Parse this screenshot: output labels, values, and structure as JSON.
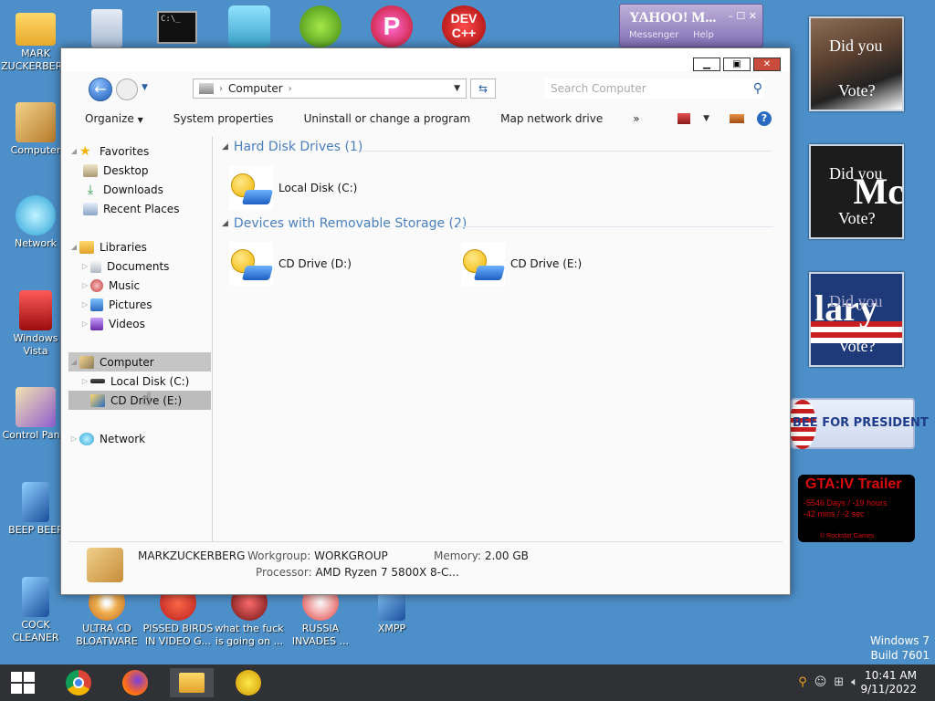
{
  "desktop": {
    "icons": [
      {
        "label": "MARK ZUCKERBERG",
        "icon": "folder-icon"
      },
      {
        "label": "Computer",
        "icon": "computer-icon"
      },
      {
        "label": "Network",
        "icon": "network-icon"
      },
      {
        "label": "Windows Vista",
        "icon": "recycle-bin-icon"
      },
      {
        "label": "Control Panel",
        "icon": "control-panel-icon"
      },
      {
        "label": "BEEP BEEP",
        "icon": "app-icon"
      },
      {
        "label": "COCK CLEANER",
        "icon": "app-icon"
      },
      {
        "label": "ULTRA CD BLOATWARE",
        "icon": "disc-icon"
      },
      {
        "label": "PISSED BIRDS IN VIDEO G...",
        "icon": "bird-icon"
      },
      {
        "label": "what the fuck is going on ...",
        "icon": "pike-icon"
      },
      {
        "label": "RUSSIA INVADES ...",
        "icon": "radiation-icon"
      },
      {
        "label": "XMPP",
        "icon": "app-icon"
      }
    ],
    "top_icons": [
      "settings-file-icon",
      "terminal-icon",
      "drive-stack-icon",
      "pig-icon",
      "p-app-icon",
      "dev-cpp-icon"
    ],
    "yahoo": {
      "brand": "YAHOO! M...",
      "messenger": "Messenger",
      "help": "Help"
    },
    "gadgets": {
      "vote1": {
        "line1": "Did you",
        "line2": "Vote?"
      },
      "vote2": {
        "line1": "Did you",
        "big": "Mc",
        "line2": "Vote?"
      },
      "vote3": {
        "big": "lary",
        "line1": "Did you",
        "line2": "Vote?"
      },
      "huckabee": "BEE FOR PRESIDENT",
      "gta": {
        "title": "GTA:IV Trailer",
        "line1": "-5546 Days / -19 hours",
        "line2": "-42 mins / -2 sec",
        "footer": "© Rockstar Games"
      }
    },
    "watermark": {
      "line1": "Windows 7",
      "line2": "Build 7601"
    }
  },
  "window": {
    "address": {
      "crumb": "Computer",
      "search_placeholder": "Search Computer"
    },
    "toolbar": {
      "organize": "Organize",
      "system_properties": "System properties",
      "uninstall": "Uninstall or change a program",
      "map_drive": "Map network drive",
      "more": "»"
    },
    "nav": {
      "favorites": "Favorites",
      "desktop": "Desktop",
      "downloads": "Downloads",
      "recent": "Recent Places",
      "libraries": "Libraries",
      "documents": "Documents",
      "music": "Music",
      "pictures": "Pictures",
      "videos": "Videos",
      "computer": "Computer",
      "local_disk": "Local Disk (C:)",
      "cd_drive": "CD Drive (E:)",
      "network": "Network"
    },
    "groups": {
      "hdd": "Hard Disk Drives (1)",
      "removable": "Devices with Removable Storage (2)"
    },
    "drives": {
      "c": "Local Disk (C:)",
      "d": "CD Drive (D:)",
      "e": "CD Drive (E:)"
    },
    "details": {
      "name": "MARKZUCKERBERG",
      "workgroup_label": "Workgroup:",
      "workgroup": "WORKGROUP",
      "memory_label": "Memory:",
      "memory": "2.00 GB",
      "processor_label": "Processor:",
      "processor": "AMD Ryzen 7 5800X 8-C..."
    }
  },
  "taskbar": {
    "time": "10:41 AM",
    "date": "9/11/2022",
    "apps": [
      "chrome-icon",
      "firefox-icon",
      "explorer-icon",
      "yahoo-icon"
    ]
  }
}
